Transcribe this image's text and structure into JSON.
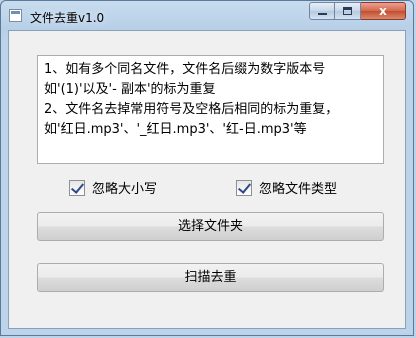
{
  "window": {
    "title": "文件去重v1.0"
  },
  "caption_buttons": {
    "minimize": "minimize",
    "maximize": "maximize",
    "close": "x"
  },
  "info_text": "1、如有多个同名文件，文件名后缀为数字版本号\n如'(1)'以及'- 副本'的标为重复\n2、文件名去掉常用符号及空格后相同的标为重复，\n如'红日.mp3'、'_红日.mp3'、'红-日.mp3'等",
  "options": {
    "ignore_case": {
      "label": "忽略大小写",
      "checked": true
    },
    "ignore_type": {
      "label": "忽略文件类型",
      "checked": true
    }
  },
  "buttons": {
    "select_folder": "选择文件夹",
    "scan_dedupe": "扫描去重"
  },
  "icons": [
    "app-icon",
    "minimize-icon",
    "maximize-icon",
    "close-icon",
    "checkbox-checked-icon"
  ]
}
